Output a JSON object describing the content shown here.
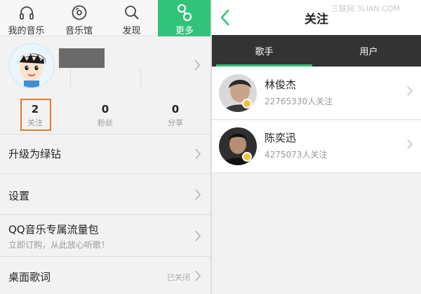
{
  "nav": {
    "items": [
      {
        "label": "我的音乐",
        "icon": "headphones-icon"
      },
      {
        "label": "音乐馆",
        "icon": "disc-icon"
      },
      {
        "label": "发现",
        "icon": "search-icon"
      },
      {
        "label": "更多",
        "icon": "more-icon"
      }
    ],
    "active_index": 3
  },
  "profile": {
    "stats": [
      {
        "value": "2",
        "label": "关注"
      },
      {
        "value": "0",
        "label": "粉丝"
      },
      {
        "value": "0",
        "label": "分享"
      }
    ]
  },
  "menu": {
    "upgrade": "升级为绿钻",
    "settings": "设置",
    "data_pack_title": "QQ音乐专属流量包",
    "data_pack_sub": "立即订购，从此放心听歌！",
    "desktop_lyrics": "桌面歌词",
    "desktop_lyrics_status": "已关闭"
  },
  "follow": {
    "title": "关注",
    "watermark": "三联网 3LIAN.COM",
    "tabs": [
      "歌手",
      "用户"
    ],
    "active_tab": 0,
    "artists": [
      {
        "name": "林俊杰",
        "fans": "22765330人关注"
      },
      {
        "name": "陈奕迅",
        "fans": "4275073人关注"
      }
    ]
  },
  "colors": {
    "accent": "#31c27c",
    "tabbar": "#333333",
    "highlight_box": "#e07b2a"
  }
}
